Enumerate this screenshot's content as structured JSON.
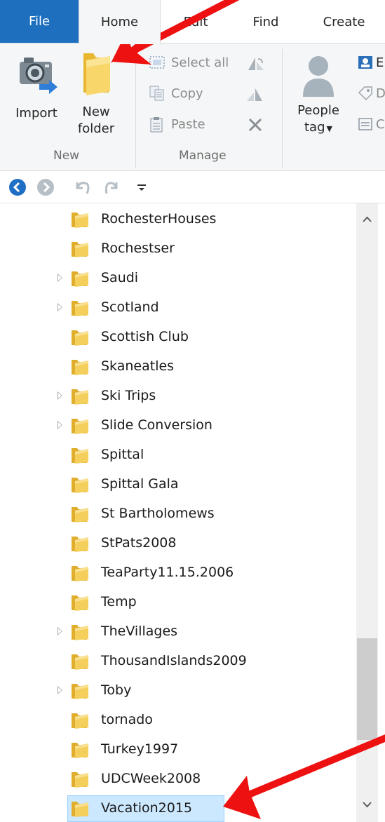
{
  "tabs": {
    "file": "File",
    "home": "Home",
    "edit": "Edit",
    "find": "Find",
    "create": "Create"
  },
  "ribbon": {
    "new_group": {
      "label": "New",
      "import_label": "Import",
      "new_folder_line1": "New",
      "new_folder_line2": "folder"
    },
    "manage_group": {
      "label": "Manage",
      "select_all": "Select all",
      "copy": "Copy",
      "paste": "Paste"
    },
    "tag_group": {
      "people_line1": "People",
      "people_line2": "tag",
      "truncated_1": "E",
      "truncated_2": "D",
      "truncated_3": "C"
    }
  },
  "tree": {
    "items": [
      {
        "name": "RochesterHouses",
        "expandable": false,
        "selected": false
      },
      {
        "name": "Rochestser",
        "expandable": false,
        "selected": false
      },
      {
        "name": "Saudi",
        "expandable": true,
        "selected": false
      },
      {
        "name": "Scotland",
        "expandable": true,
        "selected": false
      },
      {
        "name": "Scottish Club",
        "expandable": false,
        "selected": false
      },
      {
        "name": "Skaneatles",
        "expandable": false,
        "selected": false
      },
      {
        "name": "Ski Trips",
        "expandable": true,
        "selected": false
      },
      {
        "name": "Slide Conversion",
        "expandable": true,
        "selected": false
      },
      {
        "name": "Spittal",
        "expandable": false,
        "selected": false
      },
      {
        "name": "Spittal Gala",
        "expandable": false,
        "selected": false
      },
      {
        "name": "St Bartholomews",
        "expandable": false,
        "selected": false
      },
      {
        "name": "StPats2008",
        "expandable": false,
        "selected": false
      },
      {
        "name": "TeaParty11.15.2006",
        "expandable": false,
        "selected": false
      },
      {
        "name": "Temp",
        "expandable": false,
        "selected": false
      },
      {
        "name": "TheVillages",
        "expandable": true,
        "selected": false
      },
      {
        "name": "ThousandIslands2009",
        "expandable": false,
        "selected": false
      },
      {
        "name": "Toby",
        "expandable": true,
        "selected": false
      },
      {
        "name": "tornado",
        "expandable": false,
        "selected": false
      },
      {
        "name": "Turkey1997",
        "expandable": false,
        "selected": false
      },
      {
        "name": "UDCWeek2008",
        "expandable": false,
        "selected": false
      },
      {
        "name": "Vacation2015",
        "expandable": false,
        "selected": true
      }
    ]
  },
  "scrollbar": {
    "position_fraction": 0.88
  },
  "colors": {
    "file_tab": "#1e6fbe",
    "ribbon_bg": "#f5f6f7",
    "selection_fill": "#cce8ff",
    "annotation_arrow": "#ee1111",
    "folder_yellow": "#f5cf5b"
  },
  "icons": {
    "import": "camera-import-icon",
    "new_folder": "folder-icon",
    "select_all": "select-all-icon",
    "copy": "copy-icon",
    "paste": "paste-icon",
    "people_tag": "person-icon",
    "back": "back-arrow-icon",
    "forward": "forward-arrow-icon",
    "undo": "undo-icon",
    "redo": "redo-icon",
    "customize": "dropdown-icon"
  }
}
